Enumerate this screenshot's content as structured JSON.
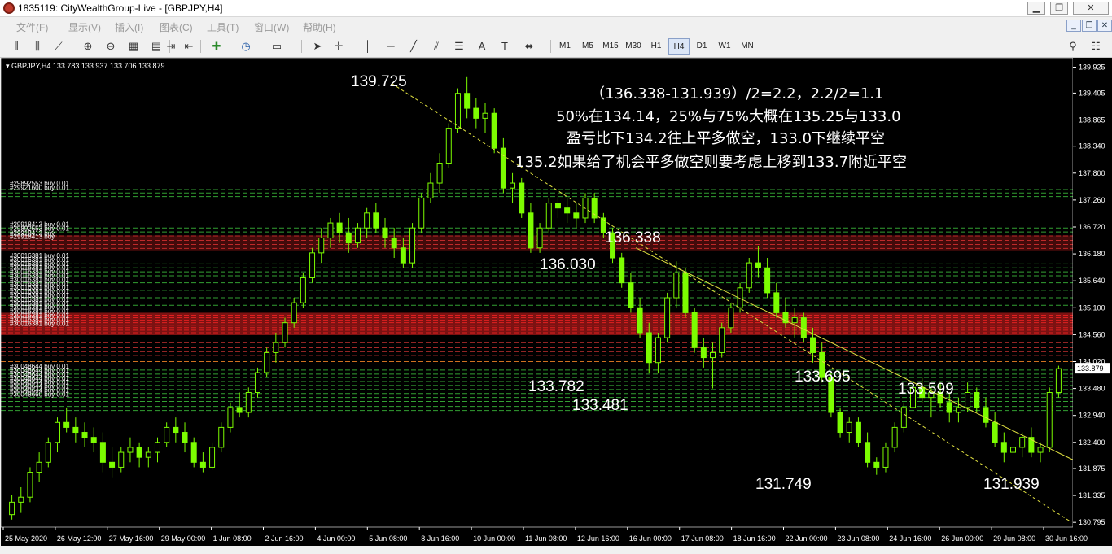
{
  "window": {
    "title": "1835119: CityWealthGroup-Live - [GBPJPY,H4]",
    "controls": [
      "▁",
      "❐",
      "✕"
    ]
  },
  "menu": [
    "文件(F)",
    "显示(V)",
    "插入(I)",
    "图表(C)",
    "工具(T)",
    "窗口(W)",
    "帮助(H)"
  ],
  "mdi_controls": [
    "_",
    "❐",
    "✕"
  ],
  "toolbar": {
    "timeframes": [
      "M1",
      "M5",
      "M15",
      "M30",
      "H1",
      "H4",
      "D1",
      "W1",
      "MN"
    ],
    "active_timeframe": "H4"
  },
  "chart": {
    "header": "GBPJPY,H4  133.783 133.937 133.706 133.879",
    "current_price": "133.879",
    "y_axis": [
      "139.925",
      "139.405",
      "138.865",
      "138.340",
      "137.800",
      "137.260",
      "136.720",
      "136.180",
      "135.640",
      "135.100",
      "134.560",
      "134.020",
      "133.480",
      "132.940",
      "132.400",
      "131.875",
      "131.335",
      "130.795"
    ],
    "x_axis": [
      "25 May 2020",
      "26 May 12:00",
      "27 May 16:00",
      "29 May 00:00",
      "1 Jun 08:00",
      "2 Jun 16:00",
      "4 Jun 00:00",
      "5 Jun 08:00",
      "8 Jun 16:00",
      "10 Jun 00:00",
      "11 Jun 08:00",
      "12 Jun 16:00",
      "16 Jun 00:00",
      "17 Jun 08:00",
      "18 Jun 16:00",
      "22 Jun 00:00",
      "23 Jun 08:00",
      "24 Jun 16:00",
      "26 Jun 00:00",
      "29 Jun 08:00",
      "30 Jun 16:00"
    ],
    "price_labels": [
      "139.725",
      "136.338",
      "136.030",
      "133.782",
      "133.481",
      "133.695",
      "133.599",
      "131.749",
      "131.939"
    ],
    "annotations": [
      "（136.338-131.939）/2=2.2，2.2/2=1.1",
      "50%在134.14，25%与75%大概在135.25与133.0",
      "盈亏比下134.2往上平多做空，133.0下继续平空",
      "135.2如果给了机会平多做空则要考虑上移到133.7附近平空"
    ],
    "order_labels": [
      "#29892553 buy 0.01",
      "#29921600 buy 0.01",
      "#29918413 buy 0.01",
      "#29892553 buy 0.01",
      "#29918413 buy",
      "#29918413 buy",
      "#30016381 buy 0.01",
      "#30016381 buy 0.01",
      "#30016381 buy 0.01",
      "#30016381 buy 0.01",
      "#30016381 buy 0.01",
      "#30016381 buy 0.01",
      "#30016381 buy 0.01",
      "#30016381 buy 0.01",
      "#30016381 buy 0.01",
      "#30016381 buy 0.01",
      "#30016381 buy 0.01",
      "#30016381 buy 0.01",
      "#30016381 buy 0.01",
      "#30016381 buy 0.01",
      "#30016381 buy 0.01",
      "#30016381 buy 0.01",
      "#30016381 buy 0.01",
      "#30016381 buy 0.01",
      "#30048644 buy 0.01",
      "#30048644 buy 0.01",
      "#30048644 buy 0.01",
      "#30048644 buy 0.01",
      "#30048644 buy 0.01",
      "#30048644 buy 0.01",
      "#30048644 buy 0.01",
      "#30048660 buy 0.01"
    ],
    "colors": {
      "bg": "#000000",
      "candle": "#7cfc00",
      "grid": "#33a033",
      "red_zone": "#e02020",
      "text": "#ffffff"
    }
  }
}
